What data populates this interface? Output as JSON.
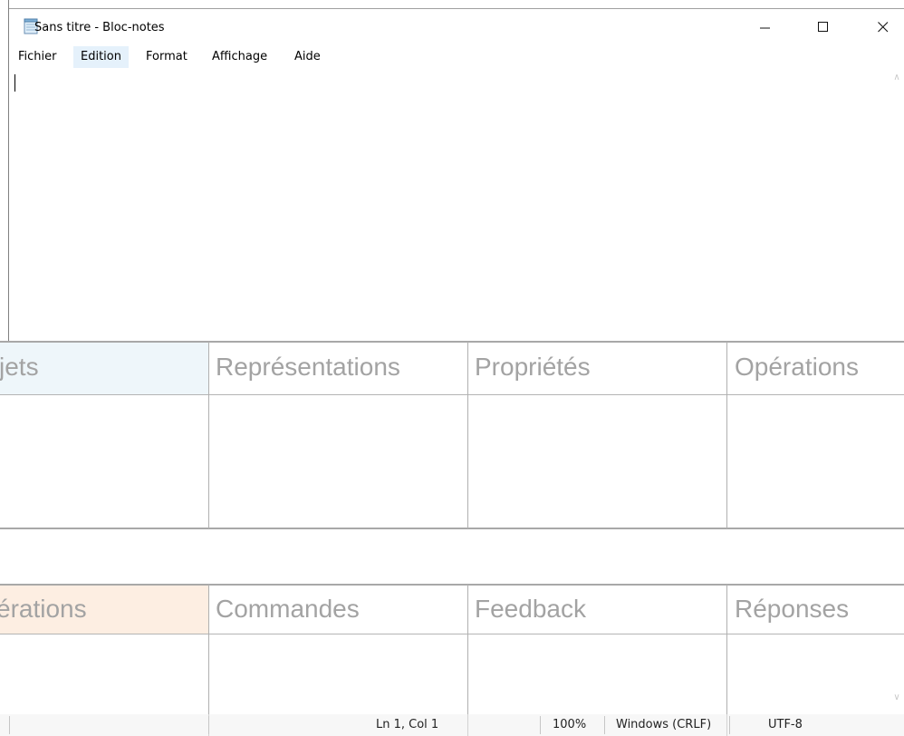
{
  "window": {
    "title": "Sans titre - Bloc-notes",
    "controls": {
      "minimize": "minimize-icon",
      "maximize": "maximize-icon",
      "close": "close-icon"
    }
  },
  "menu": {
    "items": [
      {
        "label": "Fichier"
      },
      {
        "label": "Edition",
        "active": true
      },
      {
        "label": "Format"
      },
      {
        "label": "Affichage"
      },
      {
        "label": "Aide"
      }
    ]
  },
  "editor": {
    "content": ""
  },
  "status": {
    "position": "Ln 1, Col 1",
    "zoom": "100%",
    "line_ending": "Windows (CRLF)",
    "encoding": "UTF-8"
  },
  "background_table": {
    "row1": [
      "jets",
      "Représentations",
      "Propriétés",
      "Opérations"
    ],
    "row2": [
      "érations",
      "Commandes",
      "Feedback",
      "Réponses"
    ],
    "colors": {
      "highlight_blue": "#eef6fa",
      "highlight_orange": "#fdeee2",
      "text": "#a3a3a3"
    }
  }
}
